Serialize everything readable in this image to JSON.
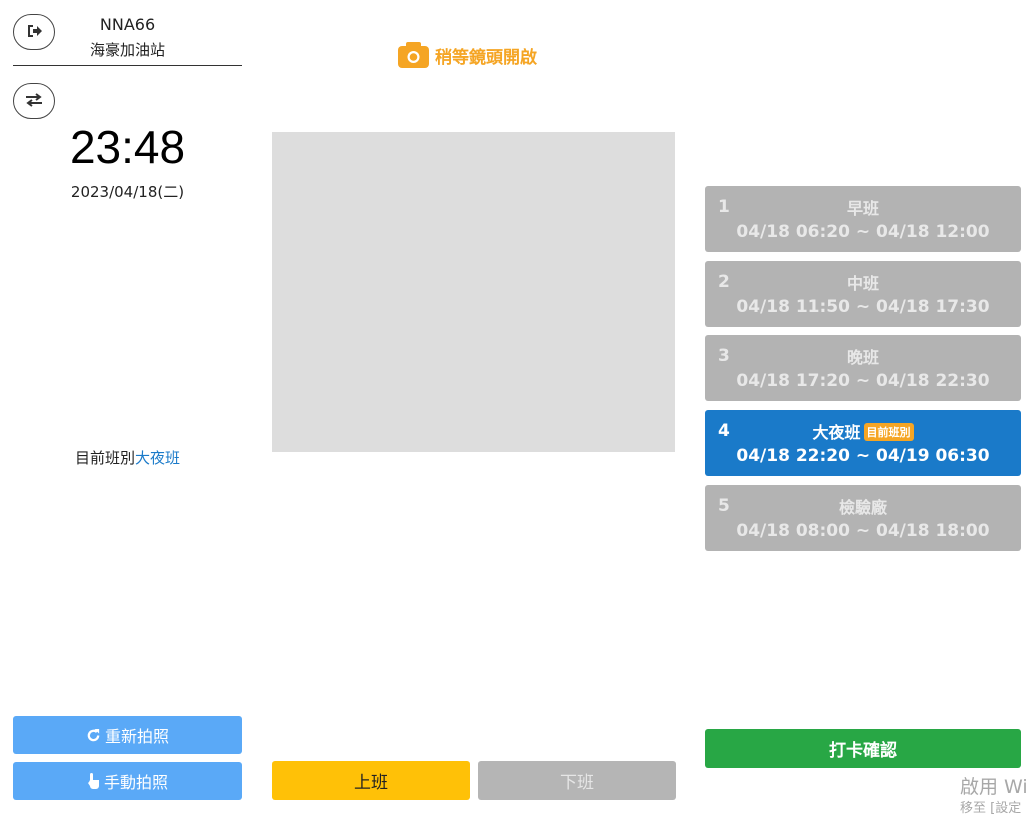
{
  "header": {
    "store_code": "NNA66",
    "store_name": "海豪加油站"
  },
  "clock": {
    "time": "23:48",
    "date": "2023/04/18(二)"
  },
  "current_shift": {
    "prefix": "目前班別",
    "value": "大夜班"
  },
  "camera": {
    "status": "稍等鏡頭開啟",
    "status_icon": "camera-icon"
  },
  "buttons": {
    "retake": "重新拍照",
    "retake_icon": "refresh-icon",
    "manual": "手動拍照",
    "manual_icon": "hand-pointer-icon",
    "clock_in": "上班",
    "clock_out": "下班",
    "confirm": "打卡確認",
    "logout_icon": "logout-icon",
    "switch_icon": "swap-icon"
  },
  "shifts": [
    {
      "num": "1",
      "name": "早班",
      "time": "04/18 06:20 ~ 04/18 12:00",
      "active": false
    },
    {
      "num": "2",
      "name": "中班",
      "time": "04/18 11:50 ~ 04/18 17:30",
      "active": false
    },
    {
      "num": "3",
      "name": "晚班",
      "time": "04/18 17:20 ~ 04/18 22:30",
      "active": false
    },
    {
      "num": "4",
      "name": "大夜班",
      "time": "04/18 22:20 ~ 04/19 06:30",
      "active": true,
      "badge": "目前班別"
    },
    {
      "num": "5",
      "name": "檢驗廠",
      "time": "04/18 08:00 ~ 04/18 18:00",
      "active": false
    }
  ],
  "watermark": {
    "line1": "啟用 Wi",
    "line2": "移至 [設定"
  },
  "colors": {
    "primary_blue": "#1a7ac9",
    "light_blue": "#5aa9f7",
    "orange": "#f5a524",
    "yellow": "#ffc107",
    "green": "#28a745",
    "gray": "#b3b3b3"
  }
}
